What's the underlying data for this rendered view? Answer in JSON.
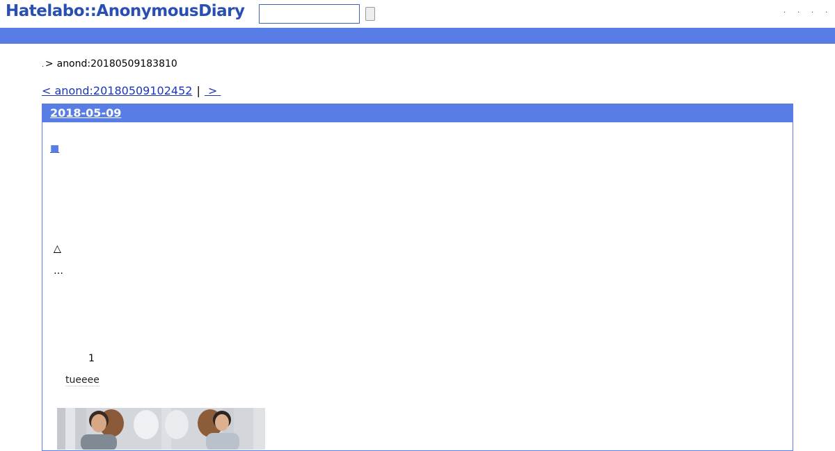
{
  "header": {
    "logo": "Hatelabo::AnonymousDiary",
    "search_value": "",
    "top_links": [
      ".",
      ".",
      ".",
      "."
    ]
  },
  "breadcrumb": {
    "home": ".",
    "separator": ">",
    "current": "anond:20180509183810"
  },
  "pager": {
    "prev": "< anond:20180509102452",
    "separator": "|",
    "next": " > "
  },
  "day": {
    "date": "2018-05-09",
    "section_mark": "■",
    "star": "△",
    "ellipsis": "…",
    "count": "1",
    "user": "tueeee"
  },
  "colors": {
    "accent": "#587de4",
    "logo": "#2a4fb2",
    "link": "#1a35b8"
  }
}
